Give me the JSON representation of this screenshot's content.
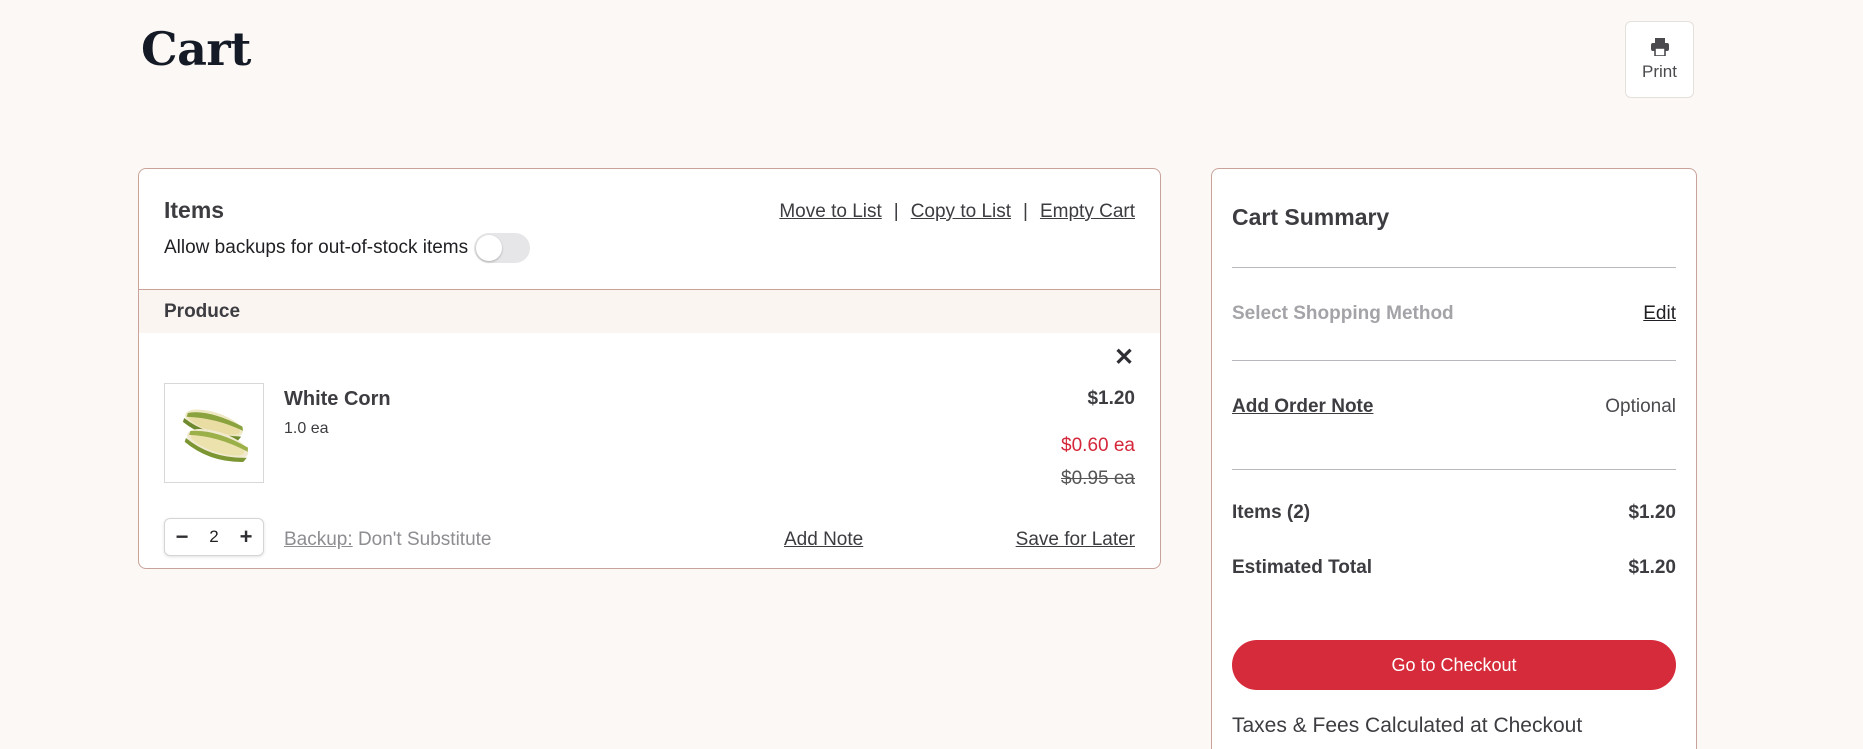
{
  "page": {
    "title": "Cart"
  },
  "print": {
    "label": "Print",
    "icon": "printer-icon"
  },
  "items_panel": {
    "title": "Items",
    "backup_toggle_label": "Allow backups for out-of-stock items",
    "backup_toggle_on": false,
    "links": {
      "move": "Move to List",
      "copy": "Copy to List",
      "empty": "Empty Cart",
      "separator": "|"
    },
    "category": "Produce",
    "item": {
      "name": "White Corn",
      "qty_text": "1.0 ea",
      "price": "$1.20",
      "sale_price": "$0.60 ea",
      "original_price": "$0.95 ea",
      "quantity": "2",
      "backup_label": "Backup:",
      "backup_value": "Don't Substitute",
      "add_note": "Add Note",
      "save_for_later": "Save for Later"
    }
  },
  "summary": {
    "title": "Cart Summary",
    "shopping_method": "Select Shopping Method",
    "edit": "Edit",
    "order_note": "Add Order Note",
    "optional": "Optional",
    "items_label": "Items (2)",
    "items_value": "$1.20",
    "total_label": "Estimated Total",
    "total_value": "$1.20",
    "checkout": "Go to Checkout",
    "taxes_note": "Taxes & Fees Calculated at Checkout"
  },
  "colors": {
    "accent": "#d62b3a",
    "background": "#fcf8f5",
    "border": "#c9a39a",
    "sale": "#d5263a"
  }
}
